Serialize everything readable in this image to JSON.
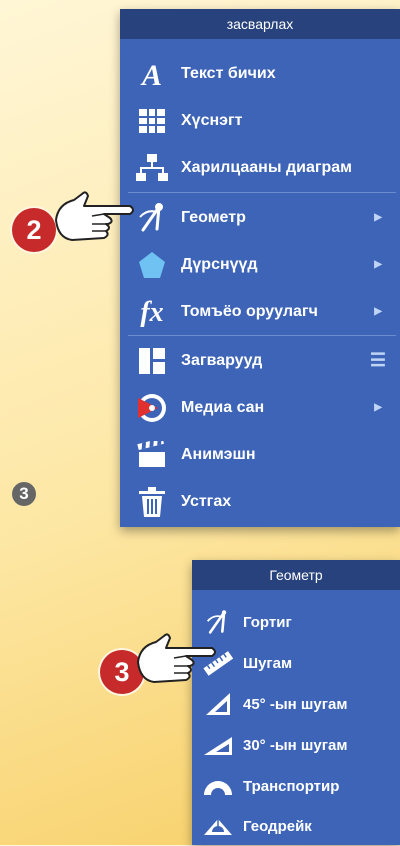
{
  "main_menu": {
    "title": "засварлах",
    "items": [
      {
        "label": "Текст бичих",
        "icon": "text-icon"
      },
      {
        "label": "Хүснэгт",
        "icon": "table-icon"
      },
      {
        "label": "Харилцааны диаграм",
        "icon": "diagram-icon"
      },
      {
        "label": "Геометр",
        "icon": "compass-icon",
        "submenu": true
      },
      {
        "label": "Дүрснүүд",
        "icon": "pentagon-icon",
        "submenu": true
      },
      {
        "label": "Томъёо оруулагч",
        "icon": "formula-icon",
        "submenu": true
      },
      {
        "label": "Загварууд",
        "icon": "layout-icon"
      },
      {
        "label": "Медиа сан",
        "icon": "media-icon",
        "submenu": true
      },
      {
        "label": "Анимэшн",
        "icon": "clapperboard-icon"
      },
      {
        "label": "Устгах",
        "icon": "trash-icon"
      }
    ]
  },
  "sub_menu": {
    "title": "Геометр",
    "items": [
      {
        "label": "Гортиг",
        "icon": "compass-icon"
      },
      {
        "label": "Шугам",
        "icon": "ruler-icon"
      },
      {
        "label": "45° -ын шугам",
        "icon": "set-square-45-icon"
      },
      {
        "label": "30° -ын шугам",
        "icon": "set-square-30-icon"
      },
      {
        "label": "Транспортир",
        "icon": "protractor-icon"
      },
      {
        "label": "Геодрейк",
        "icon": "geodreieck-icon"
      }
    ]
  },
  "callouts": {
    "step2": "2",
    "step3": "3",
    "step3_gray": "3"
  },
  "colors": {
    "panel": "#3d64b6",
    "header": "#28427e",
    "badge": "#c62a2a"
  }
}
